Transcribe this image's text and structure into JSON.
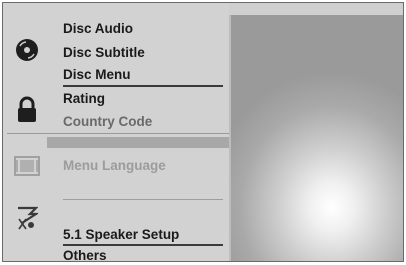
{
  "menu": {
    "disc": {
      "icon": "disc-icon",
      "items": [
        "Disc Audio",
        "Disc Subtitle",
        "Disc Menu"
      ]
    },
    "lock": {
      "icon": "padlock-icon",
      "items": [
        "Rating",
        "Country Code"
      ]
    },
    "display": {
      "icon": "display-icon",
      "items": [
        "Menu Language"
      ]
    },
    "audio": {
      "icon": "speaker-icon",
      "items": [
        "5.1 Speaker Setup"
      ]
    },
    "others": {
      "items": [
        "Others"
      ]
    }
  },
  "colors": {
    "panel": "#d2d2d2",
    "text": "#1a1a1a",
    "disabled_text": "#9c9c9c",
    "selection_bar": "#a8a8a8"
  }
}
